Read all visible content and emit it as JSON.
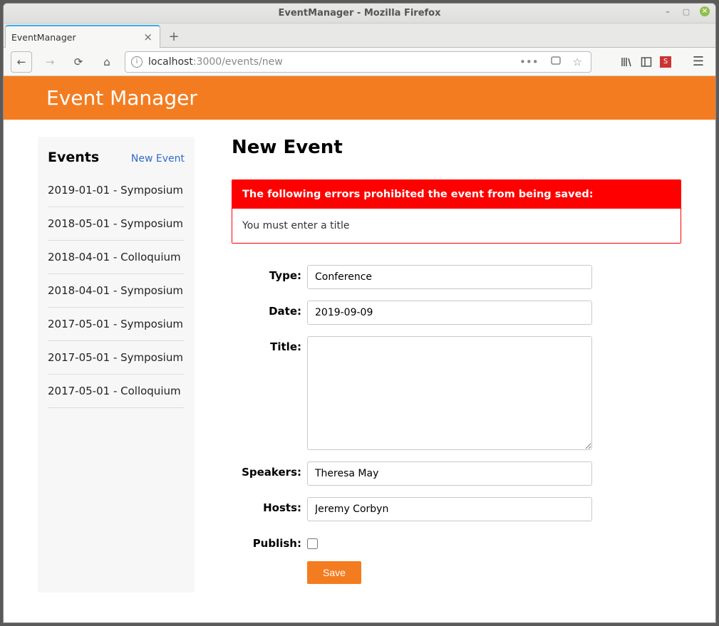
{
  "window": {
    "title": "EventManager - Mozilla Firefox"
  },
  "tab": {
    "label": "EventManager"
  },
  "url": {
    "host": "localhost",
    "path": ":3000/events/new"
  },
  "app": {
    "header_title": "Event Manager"
  },
  "sidebar": {
    "title": "Events",
    "new_link": "New Event",
    "items": [
      {
        "label": "2019-01-01 - Symposium"
      },
      {
        "label": "2018-05-01 - Symposium"
      },
      {
        "label": "2018-04-01 - Colloquium"
      },
      {
        "label": "2018-04-01 - Symposium"
      },
      {
        "label": "2017-05-01 - Symposium"
      },
      {
        "label": "2017-05-01 - Symposium"
      },
      {
        "label": "2017-05-01 - Colloquium"
      }
    ]
  },
  "main": {
    "title": "New Event",
    "error": {
      "heading": "The following errors prohibited the event from being saved:",
      "message": "You must enter a title"
    },
    "form": {
      "type_label": "Type:",
      "type_value": "Conference",
      "date_label": "Date:",
      "date_value": "2019-09-09",
      "title_label": "Title:",
      "title_value": "",
      "speakers_label": "Speakers:",
      "speakers_value": "Theresa May",
      "hosts_label": "Hosts:",
      "hosts_value": "Jeremy Corbyn",
      "publish_label": "Publish:",
      "publish_checked": false,
      "save_label": "Save"
    }
  },
  "colors": {
    "accent": "#f47c20",
    "error": "#f00",
    "link": "#2f6acb"
  }
}
